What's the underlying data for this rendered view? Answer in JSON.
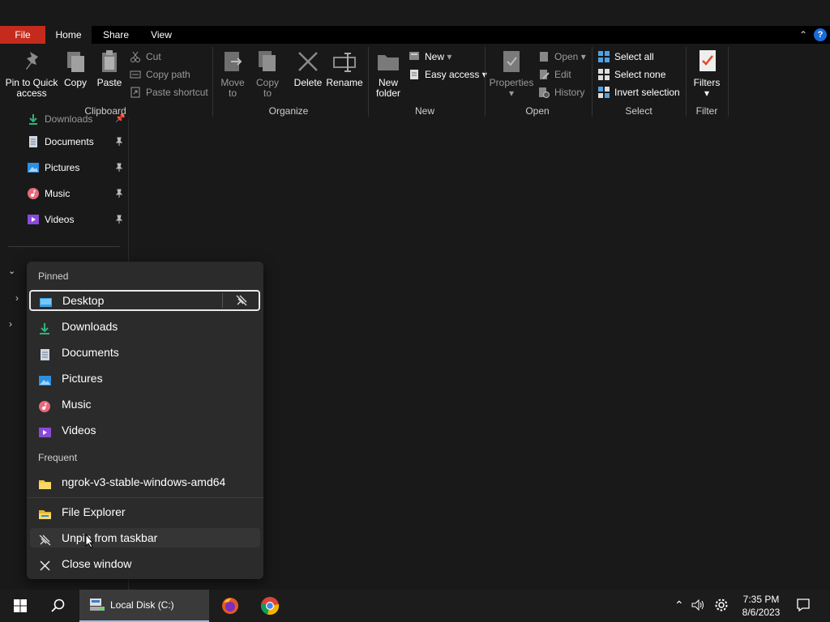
{
  "tabs": {
    "file": "File",
    "home": "Home",
    "share": "Share",
    "view": "View",
    "help": "?"
  },
  "ribbon": {
    "clipboard": {
      "label": "Clipboard",
      "pin_line1": "Pin to Quick",
      "pin_line2": "access",
      "copy": "Copy",
      "paste": "Paste",
      "cut": "Cut",
      "copy_path": "Copy path",
      "paste_shortcut": "Paste shortcut"
    },
    "organize": {
      "label": "Organize",
      "move_line1": "Move",
      "move_line2": "to",
      "copyto_line1": "Copy",
      "copyto_line2": "to",
      "delete": "Delete",
      "rename": "Rename"
    },
    "new": {
      "label": "New",
      "folder_line1": "New",
      "folder_line2": "folder",
      "new_item": "New",
      "easy_access": "Easy access"
    },
    "open": {
      "label": "Open",
      "properties": "Properties",
      "open": "Open",
      "edit": "Edit",
      "history": "History"
    },
    "select": {
      "label": "Select",
      "select_all": "Select all",
      "select_none": "Select none",
      "invert": "Invert selection"
    },
    "filter": {
      "label": "Filter",
      "filters": "Filters"
    }
  },
  "nav": {
    "partial": "Downloads",
    "items": [
      {
        "label": "Documents"
      },
      {
        "label": "Pictures"
      },
      {
        "label": "Music"
      },
      {
        "label": "Videos"
      }
    ]
  },
  "jumplist": {
    "pinned_header": "Pinned",
    "pinned": [
      {
        "label": "Desktop"
      },
      {
        "label": "Downloads"
      },
      {
        "label": "Documents"
      },
      {
        "label": "Pictures"
      },
      {
        "label": "Music"
      },
      {
        "label": "Videos"
      }
    ],
    "frequent_header": "Frequent",
    "frequent": [
      {
        "label": "ngrok-v3-stable-windows-amd64"
      }
    ],
    "actions": {
      "file_explorer": "File Explorer",
      "unpin": "Unpin from taskbar",
      "close": "Close window"
    }
  },
  "taskbar": {
    "explorer_label": "Local Disk (C:)",
    "time": "7:35 PM",
    "date": "8/6/2023"
  },
  "colors": {
    "accent_red": "#c42b1c",
    "focus_border": "#e8e8e8",
    "taskbar": "#1c1c1c"
  }
}
